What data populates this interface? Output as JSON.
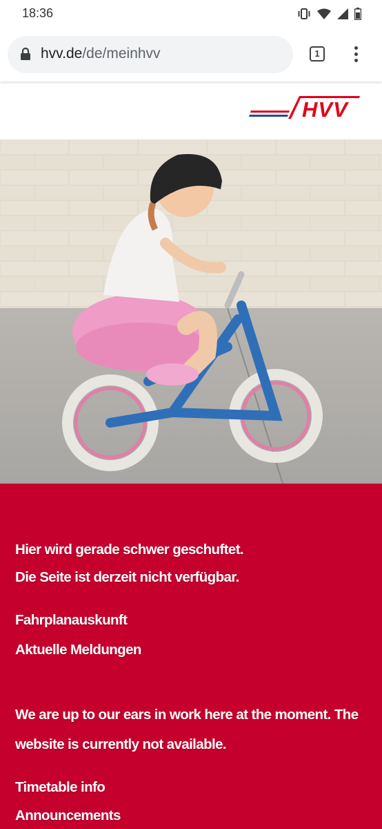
{
  "status_bar": {
    "time": "18:36",
    "icons": [
      "vibrate-icon",
      "wifi-icon",
      "signal-icon",
      "battery-icon"
    ]
  },
  "browser": {
    "url_host": "hvv.de",
    "url_path": "/de/meinhvv",
    "tab_count": "1",
    "icons": [
      "lock-icon",
      "tabs-icon",
      "more-vert-icon"
    ]
  },
  "site": {
    "logo_text": "HVV",
    "colors": {
      "brand_red": "#c5002d",
      "logo_blue": "#1d4f9b",
      "logo_red": "#e2001a"
    }
  },
  "hero": {
    "image": "child-riding-bicycle-photo"
  },
  "german": {
    "line1": "Hier wird gerade schwer geschuftet.",
    "line2": "Die Seite ist derzeit nicht verfügbar.",
    "link1": "Fahrplanauskunft",
    "link2": "Aktuelle Meldungen"
  },
  "english": {
    "line1": "We are up to our ears in work here at the moment. The",
    "line2": "website is currently not available.",
    "link1": "Timetable info",
    "link2": "Announcements"
  }
}
